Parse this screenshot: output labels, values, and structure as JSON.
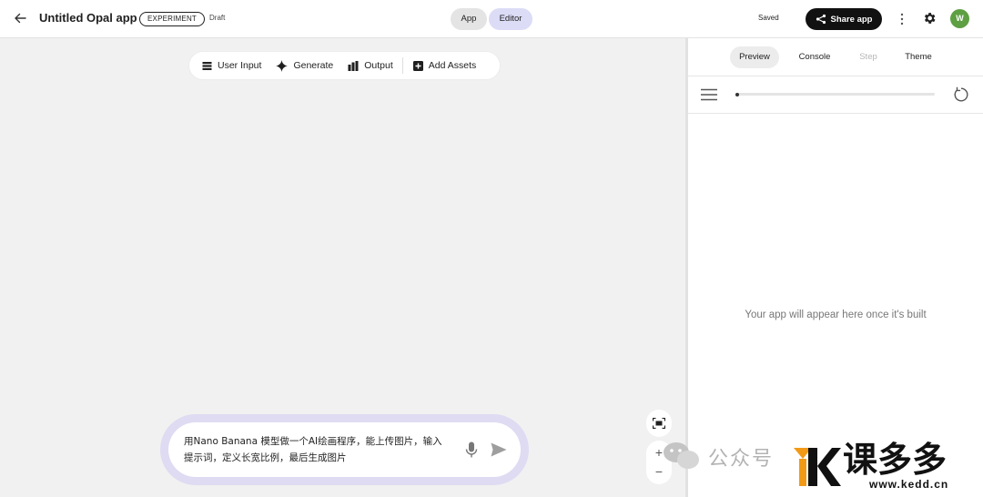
{
  "header": {
    "title": "Untitled Opal app",
    "badge": "EXPERIMENT",
    "status": "Draft",
    "mode_app": "App",
    "mode_editor": "Editor",
    "save_state": "Saved",
    "share_label": "Share app",
    "avatar_initial": "W"
  },
  "toolbar": {
    "items": [
      {
        "label": "User Input",
        "icon": "user-input-icon"
      },
      {
        "label": "Generate",
        "icon": "sparkle-icon"
      },
      {
        "label": "Output",
        "icon": "bar-chart-icon"
      },
      {
        "label": "Add Assets",
        "icon": "add-box-icon"
      }
    ]
  },
  "prompt": {
    "text": "用Nano Banana 模型做一个AI绘画程序，能上传图片，输入提示词，定义长宽比例，最后生成图片"
  },
  "zoom": {
    "in": "+",
    "out": "−"
  },
  "panel": {
    "tabs": [
      "Preview",
      "Console",
      "Step",
      "Theme"
    ],
    "progress": 0,
    "empty_message": "Your app will appear here once it's built"
  },
  "watermark": {
    "channel": "公众号",
    "brand": "课多多",
    "url": "www.kedd.cn"
  },
  "colors": {
    "editor_toggle": "#dcdcf7",
    "prompt_border": "#dedbf2",
    "avatar": "#5d9f42",
    "share_bg": "#111111"
  }
}
